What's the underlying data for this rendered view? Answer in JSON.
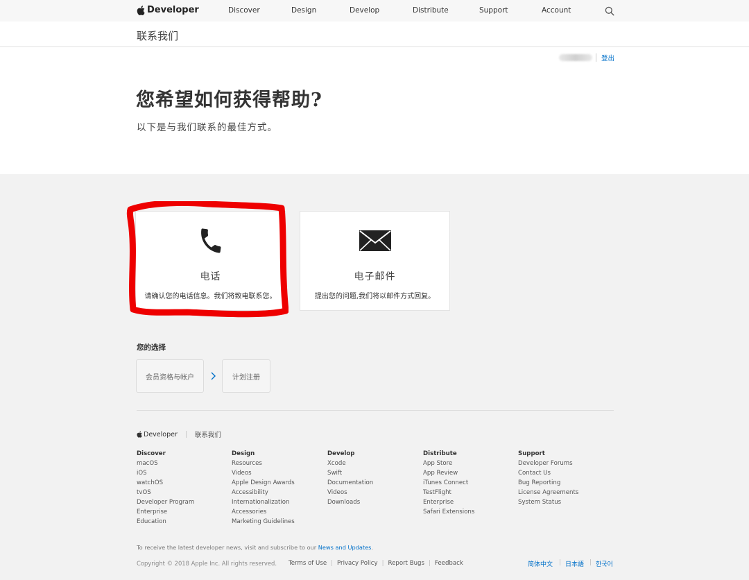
{
  "nav": {
    "brand": "Developer",
    "items": [
      "Discover",
      "Design",
      "Develop",
      "Distribute",
      "Support",
      "Account"
    ]
  },
  "localnav": {
    "title": "联系我们"
  },
  "hero": {
    "signout": "登出",
    "title": "您希望如何获得帮助?",
    "subtitle": "以下是与我们联系的最佳方式。"
  },
  "cards": [
    {
      "title": "电话",
      "description": "请确认您的电话信息。我们将致电联系您。"
    },
    {
      "title": "电子邮件",
      "description": "提出您的问题,我们将以邮件方式回复。"
    }
  ],
  "choices": {
    "title": "您的选择",
    "items": [
      "会员资格与帐户",
      "计划注册"
    ]
  },
  "footer": {
    "breadcrumb_brand": "Developer",
    "breadcrumb_current": "联系我们",
    "columns": [
      {
        "heading": "Discover",
        "links": [
          "macOS",
          "iOS",
          "watchOS",
          "tvOS",
          "Developer Program",
          "Enterprise",
          "Education"
        ]
      },
      {
        "heading": "Design",
        "links": [
          "Resources",
          "Videos",
          "Apple Design Awards",
          "Accessibility",
          "Internationalization",
          "Accessories",
          "Marketing Guidelines"
        ]
      },
      {
        "heading": "Develop",
        "links": [
          "Xcode",
          "Swift",
          "Documentation",
          "Videos",
          "Downloads"
        ]
      },
      {
        "heading": "Distribute",
        "links": [
          "App Store",
          "App Review",
          "iTunes Connect",
          "TestFlight",
          "Enterprise",
          "Safari Extensions"
        ]
      },
      {
        "heading": "Support",
        "links": [
          "Developer Forums",
          "Contact Us",
          "Bug Reporting",
          "License Agreements",
          "System Status"
        ]
      }
    ],
    "news_prefix": "To receive the latest developer news, visit and subscribe to our ",
    "news_link": "News and Updates",
    "news_suffix": ".",
    "copyright": "Copyright © 2018 Apple Inc. All rights reserved.",
    "legal_links": [
      "Terms of Use",
      "Privacy Policy",
      "Report Bugs",
      "Feedback"
    ],
    "languages": [
      "简体中文",
      "日本語",
      "한국어"
    ]
  },
  "colors": {
    "link": "#0070c9",
    "highlight": "#ee0000",
    "grey_bg": "#f2f2f2"
  }
}
